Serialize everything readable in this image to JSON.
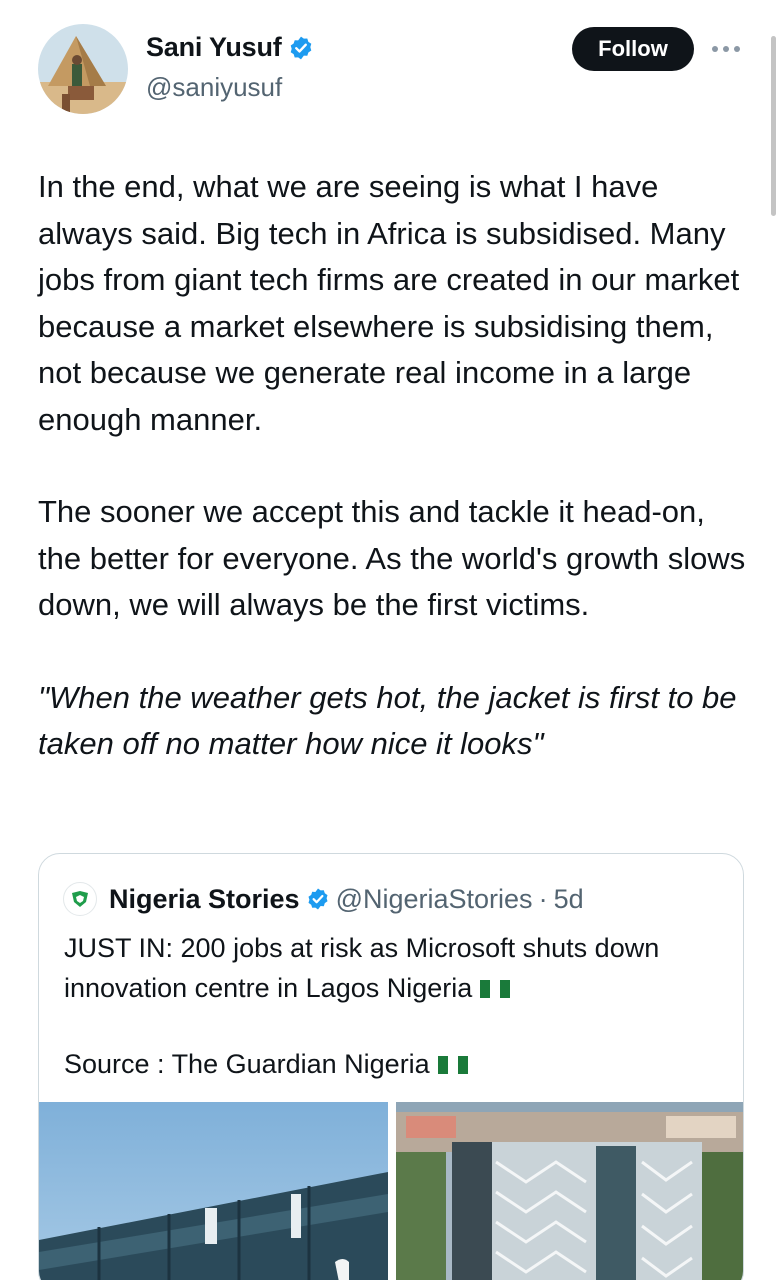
{
  "author": {
    "name": "Sani Yusuf",
    "handle": "@saniyusuf",
    "verified_icon": "verified-badge-icon",
    "avatar": "avatar-image"
  },
  "actions": {
    "follow_label": "Follow",
    "more_icon": "more-options-icon"
  },
  "tweet": {
    "paragraphs": [
      "In the end, what we are seeing is what I have always said. Big tech in Africa is subsidised. Many jobs from giant tech firms are created in our market because a market elsewhere is subsidising them, not because we generate real income in a large enough manner.",
      "The sooner we accept this and tackle it head-on, the better for everyone. As the world's growth slows down, we will always be the first victims.",
      "\"When the weather gets hot, the jacket is first to be taken off no matter how nice it looks\""
    ]
  },
  "quoted_tweet": {
    "name": "Nigeria Stories",
    "handle": "@NigeriaStories",
    "separator": "·",
    "age": "5d",
    "line1": "JUST IN: 200 jobs at risk as Microsoft shuts down innovation centre in Lagos Nigeria",
    "line2": "Source : The Guardian Nigeria",
    "flag_icon": "nigeria-flag-icon",
    "images": [
      "building-photo-left",
      "building-photo-right"
    ]
  },
  "colors": {
    "text": "#0f1419",
    "secondary": "#536471",
    "verified": "#1d9bf0",
    "follow_bg": "#0f1419",
    "border": "#cfd9de"
  }
}
